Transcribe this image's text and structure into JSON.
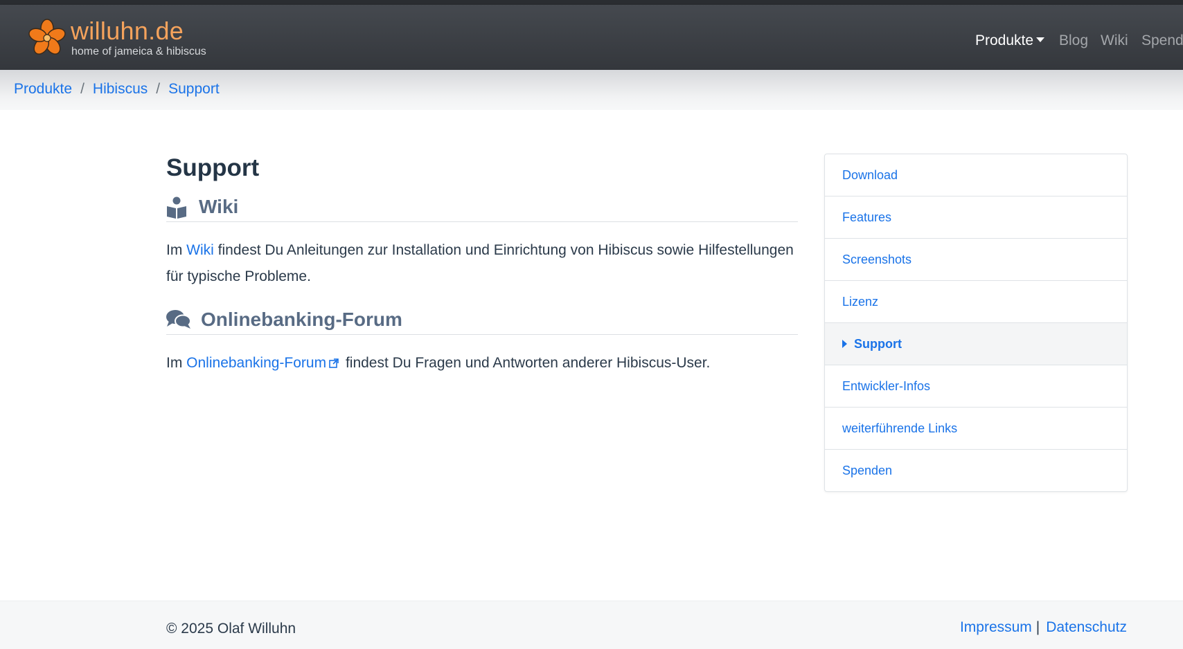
{
  "header": {
    "brand_title": "willuhn.de",
    "brand_subtitle": "home of jameica & hibiscus",
    "nav": [
      {
        "label": "Produkte",
        "active": true,
        "has_dropdown": true
      },
      {
        "label": "Blog"
      },
      {
        "label": "Wiki"
      },
      {
        "label": "Spenden"
      }
    ]
  },
  "breadcrumb": [
    "Produkte",
    "Hibiscus",
    "Support"
  ],
  "main": {
    "title": "Support",
    "sections": [
      {
        "icon": "book-reader-icon",
        "heading": "Wiki",
        "prefix": "Im ",
        "link": "Wiki",
        "suffix": " findest Du Anleitungen zur Installation und Einrichtung von Hibiscus sowie Hilfestellungen für typische Probleme."
      },
      {
        "icon": "comments-icon",
        "heading": "Onlinebanking-Forum",
        "prefix": "Im ",
        "link": "Onlinebanking-Forum",
        "suffix": " findest Du Fragen und Antworten anderer Hibiscus-User."
      }
    ]
  },
  "sidebar": {
    "items": [
      {
        "label": "Download"
      },
      {
        "label": "Features"
      },
      {
        "label": "Screenshots"
      },
      {
        "label": "Lizenz"
      },
      {
        "label": "Support",
        "active": true
      },
      {
        "label": "Entwickler-Infos"
      },
      {
        "label": "weiterführende Links"
      },
      {
        "label": "Spenden"
      }
    ]
  },
  "footer": {
    "copyright": "© 2025 Olaf Willuhn",
    "links": [
      "Impressum",
      "Datenschutz"
    ],
    "separator": "|"
  },
  "colors": {
    "link": "#1a73e8",
    "brand": "#f5a35c",
    "navbar": "#3d4045",
    "heading": "#586b84"
  }
}
